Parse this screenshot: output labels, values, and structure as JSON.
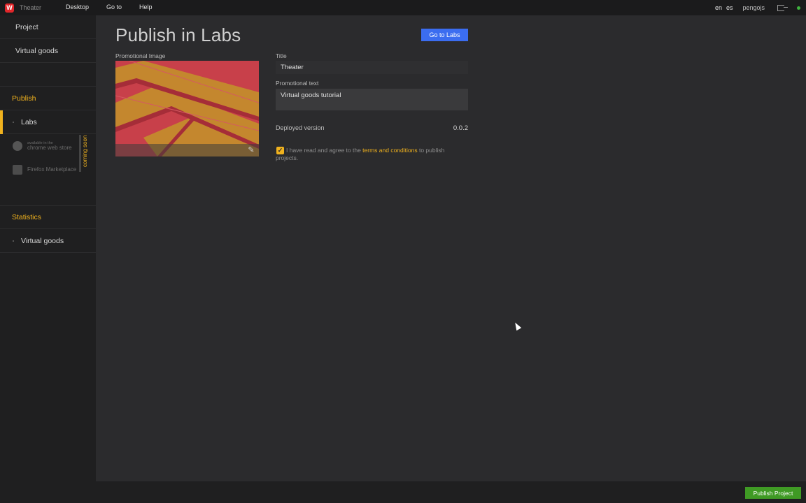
{
  "topbar": {
    "logo": "W",
    "app_title": "Theater",
    "menu": [
      "Desktop",
      "Go to",
      "Help"
    ],
    "languages": [
      "en",
      "es"
    ],
    "username": "pengojs",
    "icons": [
      "logout-icon",
      "status-dot"
    ]
  },
  "sidebar": {
    "top_items": [
      "Project",
      "Virtual goods"
    ],
    "publish_section": "Publish",
    "publish_items": [
      "Labs"
    ],
    "stores": [
      {
        "small": "available in the",
        "label": "chrome web store",
        "icon": "chrome-icon"
      },
      {
        "small": "",
        "label": "Firefox Marketplace",
        "icon": "firefox-icon"
      }
    ],
    "coming_soon": "coming soon",
    "statistics_section": "Statistics",
    "statistics_items": [
      "Virtual goods"
    ]
  },
  "main": {
    "page_title": "Publish in Labs",
    "go_to_labs": "Go to Labs",
    "promotional_image_label": "Promotional Image",
    "title_label": "Title",
    "title_value": "Theater",
    "promo_text_label": "Promotional text",
    "promo_text_value": "Virtual goods tutorial",
    "deployed_version_label": "Deployed version",
    "deployed_version_value": "0.0.2",
    "agree_before": "I have read and agree to the ",
    "agree_link": "terms and conditions",
    "agree_after": " to publish projects.",
    "agree_checked": true
  },
  "footer": {
    "publish_button": "Publish Project"
  },
  "colors": {
    "accent": "#f0b21e",
    "primary_button": "#3b6df0",
    "publish_button": "#3f9a24",
    "logo": "#e3262a"
  }
}
